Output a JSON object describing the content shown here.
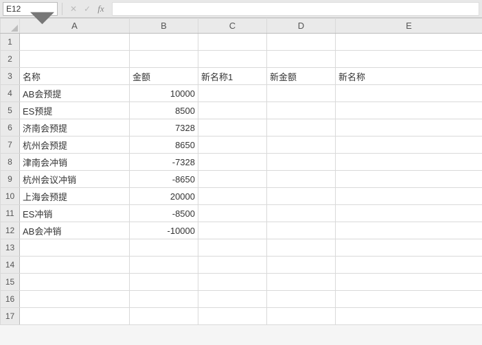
{
  "formula_bar": {
    "name_box_value": "E12",
    "cancel_glyph": "✕",
    "enter_glyph": "✓",
    "fx_label": "fx",
    "formula_value": ""
  },
  "columns": [
    "A",
    "B",
    "C",
    "D",
    "E"
  ],
  "row_count": 17,
  "rows": [
    {},
    {},
    {
      "A": "名称",
      "B": "金额",
      "C": "新名称1",
      "D": "新金额",
      "E": "新名称",
      "B_align": "text"
    },
    {
      "A": "AB会预提",
      "B": "10000"
    },
    {
      "A": "ES预提",
      "B": "8500"
    },
    {
      "A": "济南会预提",
      "B": "7328"
    },
    {
      "A": "杭州会预提",
      "B": "8650"
    },
    {
      "A": "津南会冲销",
      "B": "-7328"
    },
    {
      "A": "杭州会议冲销",
      "B": "-8650"
    },
    {
      "A": "上海会预提",
      "B": "20000"
    },
    {
      "A": "ES冲销",
      "B": "-8500"
    },
    {
      "A": "AB会冲销",
      "B": "-10000"
    },
    {},
    {},
    {},
    {},
    {}
  ],
  "chart_data": {
    "type": "table",
    "headers": [
      "名称",
      "金额",
      "新名称1",
      "新金额",
      "新名称"
    ],
    "records": [
      {
        "名称": "AB会预提",
        "金额": 10000
      },
      {
        "名称": "ES预提",
        "金额": 8500
      },
      {
        "名称": "济南会预提",
        "金额": 7328
      },
      {
        "名称": "杭州会预提",
        "金额": 8650
      },
      {
        "名称": "津南会冲销",
        "金额": -7328
      },
      {
        "名称": "杭州会议冲销",
        "金额": -8650
      },
      {
        "名称": "上海会预提",
        "金额": 20000
      },
      {
        "名称": "ES冲销",
        "金额": -8500
      },
      {
        "名称": "AB会冲销",
        "金额": -10000
      }
    ]
  }
}
